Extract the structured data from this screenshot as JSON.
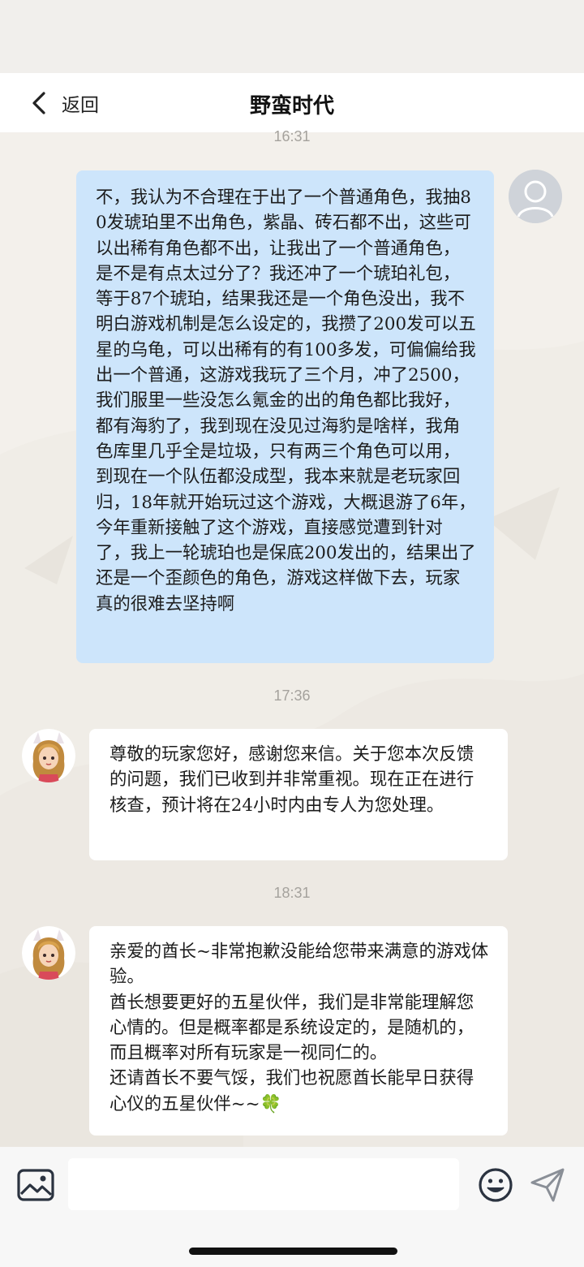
{
  "nav": {
    "back_label": "返回",
    "title": "野蛮时代"
  },
  "messages": [
    {
      "time": "16:31",
      "sender": "user",
      "text": "不，我认为不合理在于出了一个普通角色，我抽80发琥珀里不出角色，紫晶、砖石都不出，这些可以出稀有角色都不出，让我出了一个普通角色，是不是有点太过分了？我还冲了一个琥珀礼包，等于87个琥珀，结果我还是一个角色没出，我不明白游戏机制是怎么设定的，我攒了200发可以五星的乌龟，可以出稀有的有100多发，可偏偏给我出一个普通，这游戏我玩了三个月，冲了2500，我们服里一些没怎么氪金的出的角色都比我好，都有海豹了，我到现在没见过海豹是啥样，我角色库里几乎全是垃圾，只有两三个角色可以用，到现在一个队伍都没成型，我本来就是老玩家回归，18年就开始玩过这个游戏，大概退游了6年，今年重新接触了这个游戏，直接感觉遭到针对了，我上一轮琥珀也是保底200发出的，结果出了还是一个歪颜色的角色，游戏这样做下去，玩家真的很难去坚持啊"
    },
    {
      "time": "17:36",
      "sender": "support",
      "text": "尊敬的玩家您好，感谢您来信。关于您本次反馈的问题，我们已收到并非常重视。现在正在进行核查，预计将在24小时内由专人为您处理。"
    },
    {
      "time": "18:31",
      "sender": "support",
      "text": "亲爱的酋长~非常抱歉没能给您带来满意的游戏体验。\n酋长想要更好的五星伙伴，我们是非常能理解您心情的。但是概率都是系统设定的，是随机的，而且概率对所有玩家是一视同仁的。\n还请酋长不要气馁，我们也祝愿酋长能早日获得心仪的五星伙伴~~🍀"
    }
  ],
  "input": {
    "placeholder": ""
  },
  "icons": {
    "back": "chevron-left-icon",
    "image": "image-icon",
    "emoji": "smiley-icon",
    "send": "paper-plane-icon",
    "user_avatar": "default-avatar-icon",
    "support_avatar": "support-character-avatar"
  },
  "colors": {
    "user_bubble": "#cde5fb",
    "support_bubble": "#ffffff",
    "background": "#f3f0eb",
    "timestamp": "#a5a29d"
  }
}
